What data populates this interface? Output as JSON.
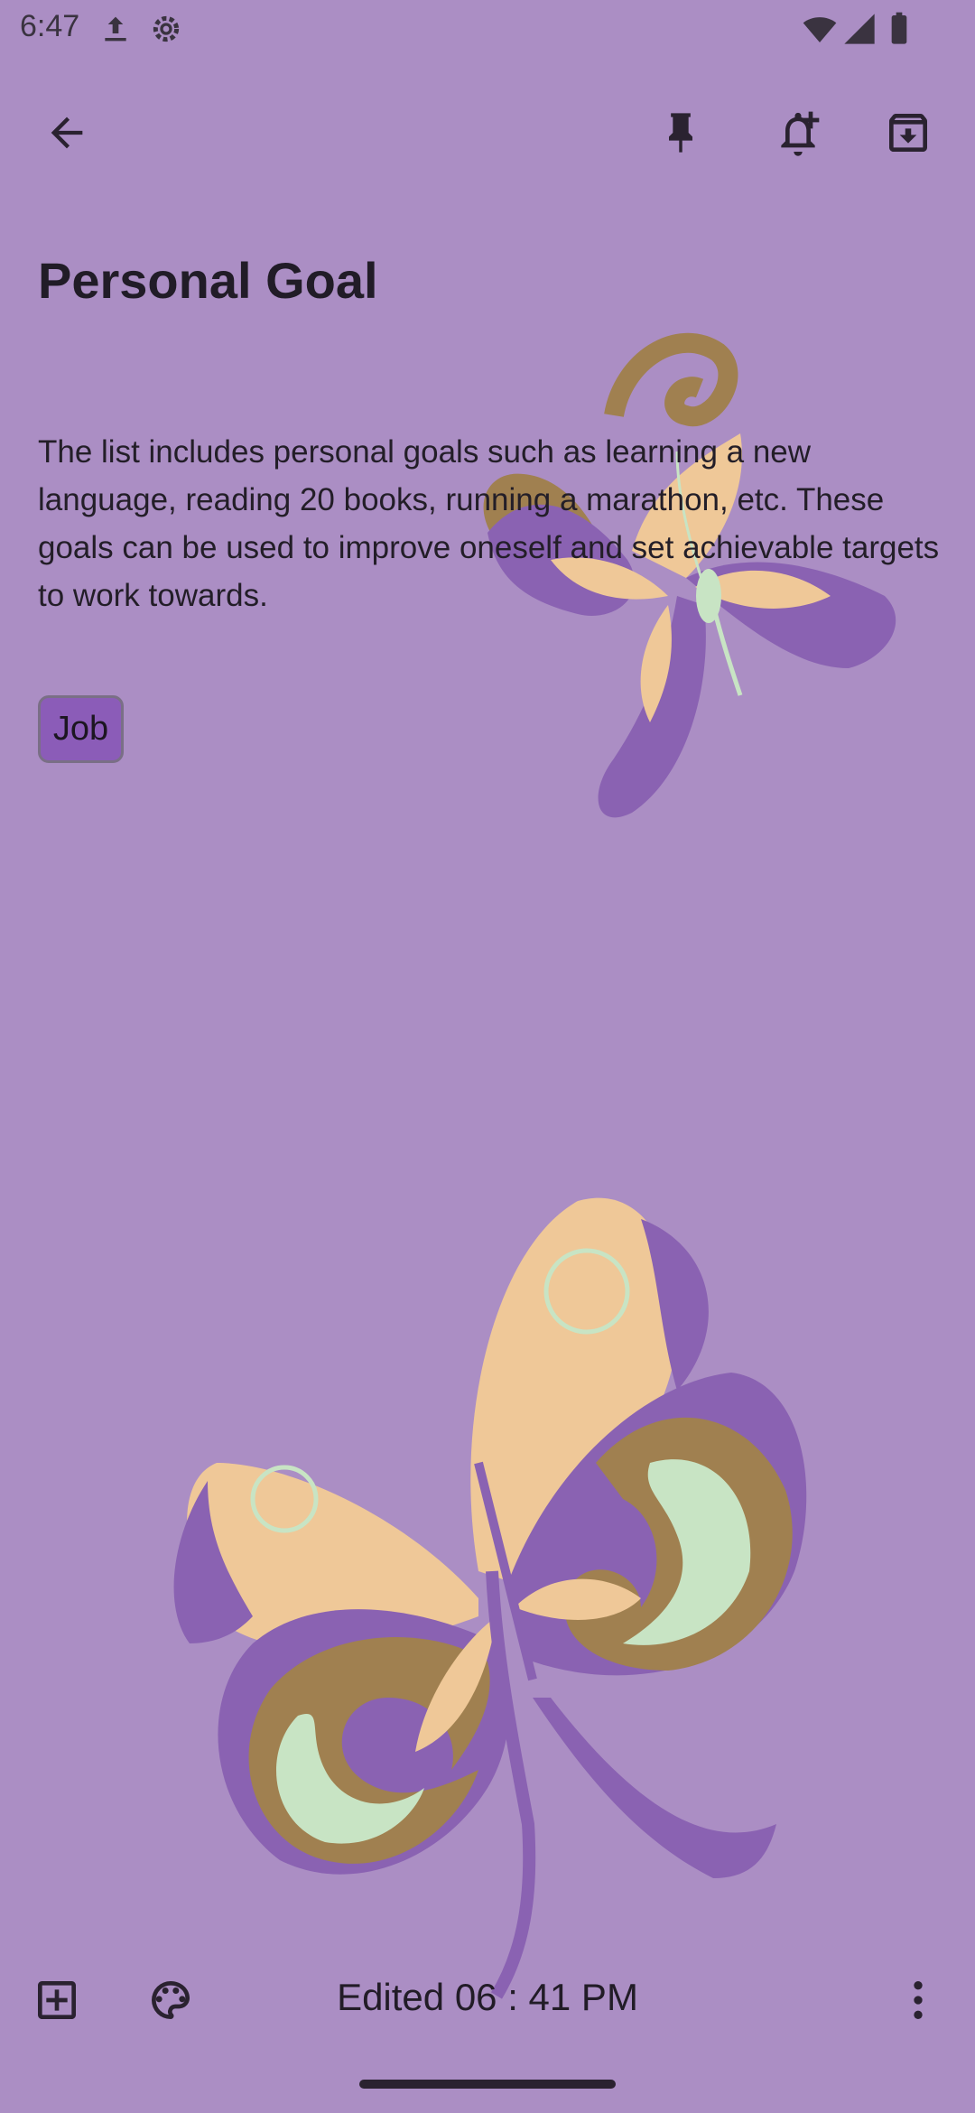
{
  "status_bar": {
    "time": "6:47",
    "icons": [
      "upload-icon",
      "settings-gear-icon",
      "wifi-icon",
      "signal-icon",
      "battery-icon"
    ]
  },
  "toolbar": {
    "back": "arrow-back-icon",
    "pin": "pin-icon",
    "reminder": "add-alert-icon",
    "archive": "archive-icon"
  },
  "note": {
    "title": "Personal Goal",
    "body": "The list includes personal goals such as learning a new language, reading 20 books, running a marathon, etc. These goals can be used to improve oneself and set achievable targets to work towards.",
    "label": "Job"
  },
  "bottom_bar": {
    "add": "add-box-icon",
    "palette": "palette-icon",
    "edited": "Edited 06 : 41 PM",
    "more": "more-vert-icon"
  },
  "colors": {
    "background": "#ab8ec4",
    "chip": "#8b5cb8",
    "butterfly_purple": "#8a62b2",
    "butterfly_peach": "#efc898",
    "butterfly_brown": "#a08050",
    "butterfly_mint": "#c8e4c4"
  }
}
